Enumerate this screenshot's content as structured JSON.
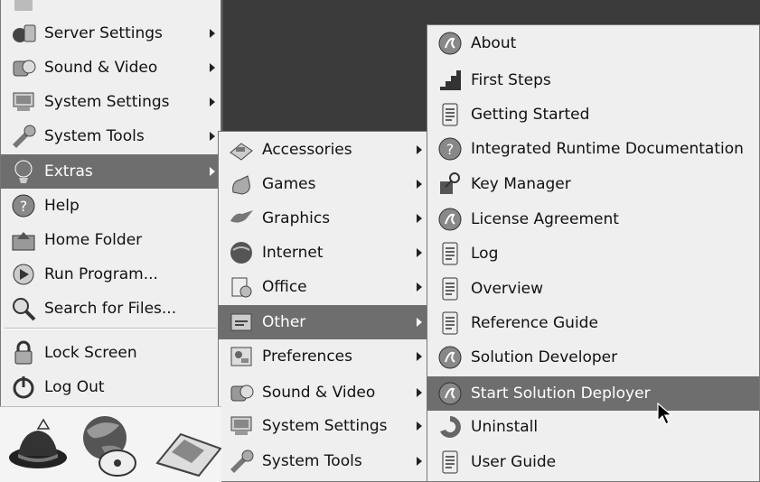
{
  "main_menu": {
    "items": [
      {
        "label": "",
        "icon": "partial-icon"
      },
      {
        "label": "Server Settings",
        "icon": "server-icon",
        "submenu": true
      },
      {
        "label": "Sound & Video",
        "icon": "sound-video-icon",
        "submenu": true
      },
      {
        "label": "System Settings",
        "icon": "system-settings-icon",
        "submenu": true
      },
      {
        "label": "System Tools",
        "icon": "system-tools-icon",
        "submenu": true
      },
      {
        "label": "Extras",
        "icon": "extras-icon",
        "submenu": true,
        "selected": true
      },
      {
        "label": "Help",
        "icon": "help-icon"
      },
      {
        "label": "Home Folder",
        "icon": "home-folder-icon"
      },
      {
        "label": "Run Program...",
        "icon": "run-program-icon"
      },
      {
        "label": "Search for Files...",
        "icon": "search-icon"
      },
      {
        "label": "Lock Screen",
        "icon": "lock-icon"
      },
      {
        "label": "Log Out",
        "icon": "logout-icon"
      }
    ]
  },
  "extras_menu": {
    "items": [
      {
        "label": "Accessories",
        "icon": "accessories-icon",
        "submenu": true
      },
      {
        "label": "Games",
        "icon": "games-icon",
        "submenu": true
      },
      {
        "label": "Graphics",
        "icon": "graphics-icon",
        "submenu": true
      },
      {
        "label": "Internet",
        "icon": "internet-icon",
        "submenu": true
      },
      {
        "label": "Office",
        "icon": "office-icon",
        "submenu": true
      },
      {
        "label": "Other",
        "icon": "other-icon",
        "submenu": true,
        "selected": true
      },
      {
        "label": "Preferences",
        "icon": "preferences-icon",
        "submenu": true
      },
      {
        "label": "Sound & Video",
        "icon": "sound-video-icon",
        "submenu": true
      },
      {
        "label": "System Settings",
        "icon": "system-settings-icon",
        "submenu": true
      },
      {
        "label": "System Tools",
        "icon": "system-tools-icon",
        "submenu": true
      }
    ]
  },
  "other_menu": {
    "items": [
      {
        "label": "About",
        "icon": "solution-icon"
      },
      {
        "label": "First Steps",
        "icon": "first-steps-icon"
      },
      {
        "label": "Getting Started",
        "icon": "document-icon"
      },
      {
        "label": "Integrated Runtime Documentation",
        "icon": "help-icon"
      },
      {
        "label": "Key Manager",
        "icon": "key-icon"
      },
      {
        "label": "License Agreement",
        "icon": "solution-icon"
      },
      {
        "label": "Log",
        "icon": "document-icon"
      },
      {
        "label": "Overview",
        "icon": "document-icon"
      },
      {
        "label": "Reference Guide",
        "icon": "document-icon"
      },
      {
        "label": "Solution Developer",
        "icon": "solution-icon"
      },
      {
        "label": "Start Solution Deployer",
        "icon": "solution-icon",
        "selected": true
      },
      {
        "label": "Uninstall",
        "icon": "uninstall-icon"
      },
      {
        "label": "User Guide",
        "icon": "document-icon"
      }
    ]
  },
  "panel": {
    "launchers": [
      "redhat-hat-icon",
      "web-browser-icon",
      "mail-icon"
    ]
  },
  "colors": {
    "selection": "#6e6e6e",
    "menu_bg": "#efefef",
    "desktop": "#3b3b3b"
  }
}
